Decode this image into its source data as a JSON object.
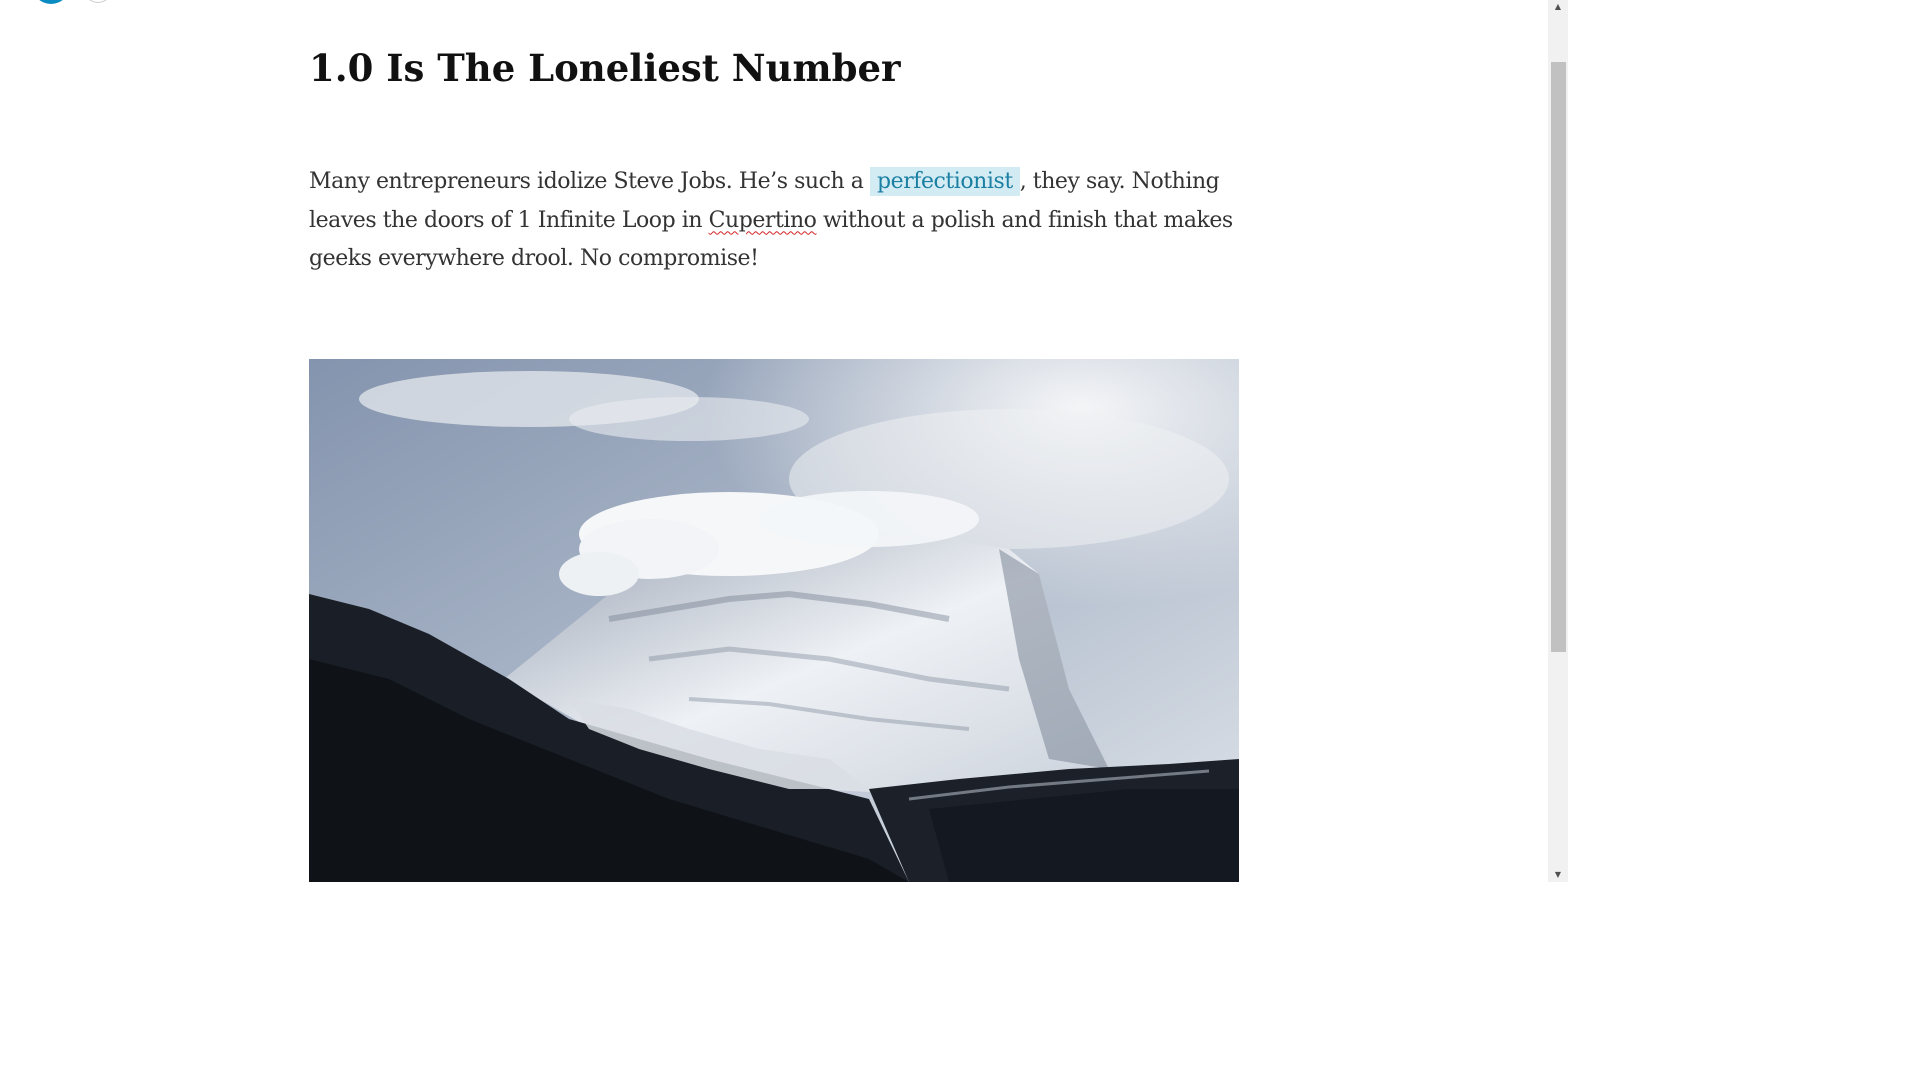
{
  "article": {
    "title": "1.0 Is The Loneliest Number",
    "paragraph": {
      "before_link": "Many entrepreneurs idolize Steve Jobs. He’s such a ",
      "link_text": "perfectionist",
      "after_link": ", they say. Nothing leaves the doors of 1 Infinite Loop in ",
      "misspelled_word": "Cupertino",
      "after_misspelled": " without a polish and finish that makes geeks everywhere drool. No compromise!"
    },
    "image": {
      "subject": "snow-capped mountain with cloud cap above dark forested hills"
    }
  },
  "colors": {
    "accent": "#0a8bc2",
    "link_background": "#d3ecf4",
    "link_text": "#1b7fa3",
    "title_text": "#111111",
    "body_text": "#333333"
  },
  "icons": {
    "top_left_primary": "circle-badge-icon",
    "top_left_secondary": "circle-outline-icon",
    "scroll_up": "arrow-up-icon",
    "scroll_down": "arrow-down-icon"
  }
}
